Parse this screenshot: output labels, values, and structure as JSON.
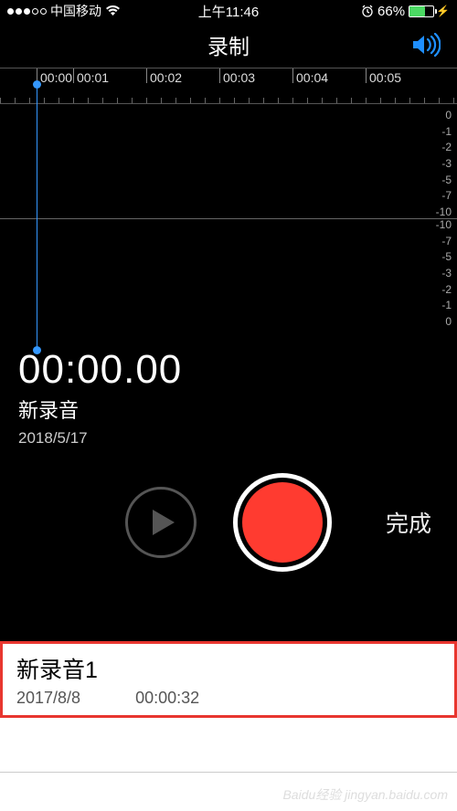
{
  "status": {
    "carrier": "中国移动",
    "time": "上午11:46",
    "battery_pct": "66%"
  },
  "header": {
    "title": "录制"
  },
  "ruler": {
    "ticks": [
      "00:00",
      "00:01",
      "00:02",
      "00:03",
      "00:04",
      "00:05"
    ]
  },
  "waveform": {
    "db_top": [
      "0",
      "-1",
      "-2",
      "-3",
      "-5",
      "-7",
      "-10"
    ],
    "db_bottom": [
      "-10",
      "-7",
      "-5",
      "-3",
      "-2",
      "-1",
      "0"
    ]
  },
  "recorder": {
    "timer": "00:00.00",
    "name": "新录音",
    "date": "2018/5/17"
  },
  "controls": {
    "done_label": "完成"
  },
  "recordings": [
    {
      "title": "新录音1",
      "date": "2017/8/8",
      "duration": "00:00:32"
    }
  ],
  "watermark": "Baidu经验 jingyan.baidu.com"
}
